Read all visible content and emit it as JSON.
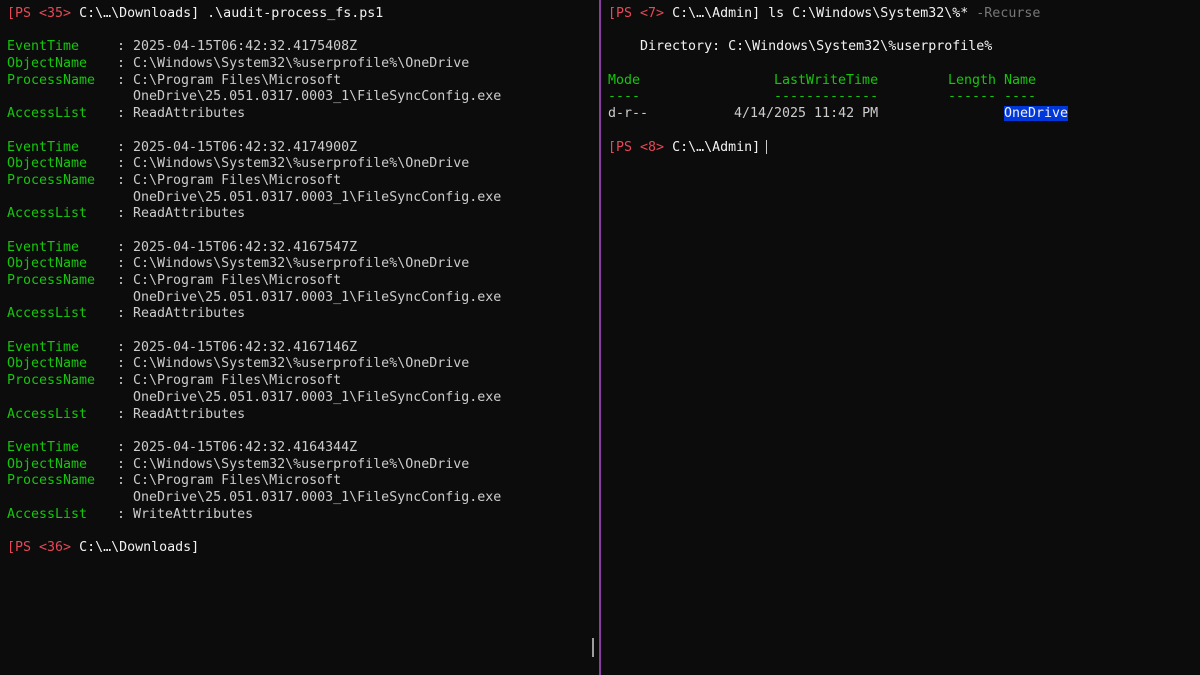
{
  "left_pane": {
    "prompt1": {
      "tag": "[PS <35>",
      "path": "C:\\…\\Downloads]",
      "command": ".\\audit-process_fs.ps1"
    },
    "labels": {
      "event_time": "EventTime",
      "object_name": "ObjectName",
      "process_name": "ProcessName",
      "access_list": "AccessList",
      "sep": ": "
    },
    "records": [
      {
        "event_time": "2025-04-15T06:42:32.4175408Z",
        "object_name": "C:\\Windows\\System32\\%userprofile%\\OneDrive",
        "process_name_1": "C:\\Program Files\\Microsoft",
        "process_name_2": "OneDrive\\25.051.0317.0003_1\\FileSyncConfig.exe",
        "access_list": "ReadAttributes"
      },
      {
        "event_time": "2025-04-15T06:42:32.4174900Z",
        "object_name": "C:\\Windows\\System32\\%userprofile%\\OneDrive",
        "process_name_1": "C:\\Program Files\\Microsoft",
        "process_name_2": "OneDrive\\25.051.0317.0003_1\\FileSyncConfig.exe",
        "access_list": "ReadAttributes"
      },
      {
        "event_time": "2025-04-15T06:42:32.4167547Z",
        "object_name": "C:\\Windows\\System32\\%userprofile%\\OneDrive",
        "process_name_1": "C:\\Program Files\\Microsoft",
        "process_name_2": "OneDrive\\25.051.0317.0003_1\\FileSyncConfig.exe",
        "access_list": "ReadAttributes"
      },
      {
        "event_time": "2025-04-15T06:42:32.4167146Z",
        "object_name": "C:\\Windows\\System32\\%userprofile%\\OneDrive",
        "process_name_1": "C:\\Program Files\\Microsoft",
        "process_name_2": "OneDrive\\25.051.0317.0003_1\\FileSyncConfig.exe",
        "access_list": "ReadAttributes"
      },
      {
        "event_time": "2025-04-15T06:42:32.4164344Z",
        "object_name": "C:\\Windows\\System32\\%userprofile%\\OneDrive",
        "process_name_1": "C:\\Program Files\\Microsoft",
        "process_name_2": "OneDrive\\25.051.0317.0003_1\\FileSyncConfig.exe",
        "access_list": "WriteAttributes"
      }
    ],
    "prompt2": {
      "tag": "[PS <36>",
      "path": "C:\\…\\Downloads]"
    }
  },
  "right_pane": {
    "prompt1": {
      "tag": "[PS <7>",
      "path": "C:\\…\\Admin]",
      "command": "ls C:\\Windows\\System32\\%*",
      "param": "-Recurse"
    },
    "directory_line": "    Directory: C:\\Windows\\System32\\%userprofile%",
    "headers": {
      "mode": "Mode",
      "last_write_time": "LastWriteTime",
      "length": "Length",
      "name": "Name"
    },
    "underlines": {
      "mode": "----",
      "last_write_time": "-------------",
      "length": "------",
      "name": "----"
    },
    "row": {
      "mode": "d-r--",
      "last_write_time": "4/14/2025 11:42 PM",
      "length": "",
      "name": "OneDrive"
    },
    "prompt2": {
      "tag": "[PS <8>",
      "path": "C:\\…\\Admin]"
    }
  },
  "colors": {
    "background": "#0c0c0c",
    "prompt_red": "#e74856",
    "label_green": "#16c60c",
    "divider_purple": "#8a3fa0",
    "selection_blue": "#0037da"
  }
}
